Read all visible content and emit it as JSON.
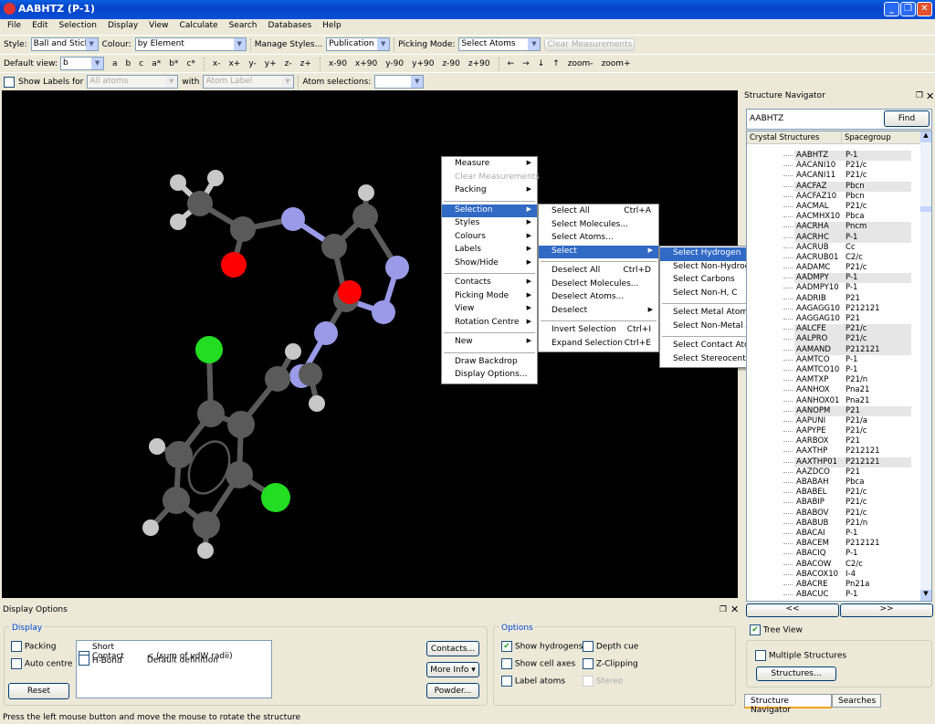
{
  "window": {
    "title": "AABHTZ (P-1)"
  },
  "menubar": [
    "File",
    "Edit",
    "Selection",
    "Display",
    "View",
    "Calculate",
    "Search",
    "Databases",
    "Help"
  ],
  "toolbar1": {
    "style_label": "Style:",
    "style_value": "Ball and Stick",
    "colour_label": "Colour:",
    "colour_value": "by Element",
    "manage_styles": "Manage Styles...",
    "manage_value": "Publication",
    "picking_label": "Picking Mode:",
    "picking_value": "Select Atoms",
    "clear_measurements": "Clear Measurements"
  },
  "toolbar2": {
    "default_view_label": "Default view:",
    "default_view_value": "b",
    "axes": [
      "a",
      "b",
      "c",
      "a*",
      "b*",
      "c*"
    ],
    "rot": [
      "x-",
      "x+",
      "y-",
      "y+",
      "z-",
      "z+"
    ],
    "rot90": [
      "x-90",
      "x+90",
      "y-90",
      "y+90",
      "z-90",
      "z+90"
    ],
    "arrows": [
      "←",
      "→",
      "↓",
      "↑"
    ],
    "zoom": [
      "zoom-",
      "zoom+"
    ]
  },
  "toolbar3": {
    "show_labels": "Show Labels for",
    "labels_for": "All atoms",
    "with": "with",
    "with_value": "Atom Label",
    "atom_selections": "Atom selections:",
    "atom_selections_value": ""
  },
  "context_menu": {
    "main": [
      {
        "label": "Measure",
        "sub": true
      },
      {
        "label": "Clear Measurements",
        "disabled": true
      },
      {
        "label": "Packing",
        "sub": true
      },
      {
        "sep": true
      },
      {
        "label": "Selection",
        "sub": true,
        "hl": true
      },
      {
        "label": "Styles",
        "sub": true
      },
      {
        "label": "Colours",
        "sub": true
      },
      {
        "label": "Labels",
        "sub": true
      },
      {
        "label": "Show/Hide",
        "sub": true
      },
      {
        "sep": true
      },
      {
        "label": "Contacts",
        "sub": true
      },
      {
        "label": "Picking Mode",
        "sub": true
      },
      {
        "label": "View",
        "sub": true
      },
      {
        "label": "Rotation Centre",
        "sub": true
      },
      {
        "sep": true
      },
      {
        "label": "New",
        "sub": true
      },
      {
        "sep": true
      },
      {
        "label": "Draw Backdrop"
      },
      {
        "label": "Display Options..."
      }
    ],
    "selection": [
      {
        "label": "Select All",
        "shortcut": "Ctrl+A"
      },
      {
        "label": "Select Molecules..."
      },
      {
        "label": "Select Atoms..."
      },
      {
        "label": "Select",
        "sub": true,
        "hl": true
      },
      {
        "sep": true
      },
      {
        "label": "Deselect All",
        "shortcut": "Ctrl+D"
      },
      {
        "label": "Deselect Molecules..."
      },
      {
        "label": "Deselect Atoms..."
      },
      {
        "label": "Deselect",
        "sub": true
      },
      {
        "sep": true
      },
      {
        "label": "Invert Selection",
        "shortcut": "Ctrl+I"
      },
      {
        "label": "Expand Selection",
        "shortcut": "Ctrl+E"
      }
    ],
    "select": [
      {
        "label": "Select Hydrogen",
        "hl": true
      },
      {
        "label": "Select Non-Hydrogen"
      },
      {
        "label": "Select Carbons"
      },
      {
        "label": "Select Non-H, C"
      },
      {
        "sep": true
      },
      {
        "label": "Select Metal Atoms"
      },
      {
        "label": "Select Non-Metal Atoms"
      },
      {
        "sep": true
      },
      {
        "label": "Select Contact Atoms"
      },
      {
        "label": "Select Stereocentres"
      }
    ]
  },
  "navigator": {
    "title": "Structure Navigator",
    "search_value": "AABHTZ",
    "find": "Find",
    "col_name": "Crystal Structures",
    "col_sg": "Spacegroup",
    "rows": [
      [
        "AABHTZ",
        "P-1",
        1
      ],
      [
        "AACANI10",
        "P21/c",
        0
      ],
      [
        "AACANI11",
        "P21/c",
        0
      ],
      [
        "AACFAZ",
        "Pbcn",
        1
      ],
      [
        "AACFAZ10",
        "Pbcn",
        0
      ],
      [
        "AACMAL",
        "P21/c",
        0
      ],
      [
        "AACMHX10",
        "Pbca",
        0
      ],
      [
        "AACRHA",
        "Pncm",
        1
      ],
      [
        "AACRHC",
        "P-1",
        1
      ],
      [
        "AACRUB",
        "Cc",
        0
      ],
      [
        "AACRUB01",
        "C2/c",
        0
      ],
      [
        "AADAMC",
        "P21/c",
        0
      ],
      [
        "AADMPY",
        "P-1",
        1
      ],
      [
        "AADMPY10",
        "P-1",
        0
      ],
      [
        "AADRIB",
        "P21",
        0
      ],
      [
        "AAGAGG10",
        "P212121",
        0
      ],
      [
        "AAGGAG10",
        "P21",
        0
      ],
      [
        "AALCFE",
        "P21/c",
        1
      ],
      [
        "AALPRO",
        "P21/c",
        1
      ],
      [
        "AAMAND",
        "P212121",
        1
      ],
      [
        "AAMTCO",
        "P-1",
        0
      ],
      [
        "AAMTCO10",
        "P-1",
        0
      ],
      [
        "AAMTXP",
        "P21/n",
        0
      ],
      [
        "AANHOX",
        "Pna21",
        0
      ],
      [
        "AANHOX01",
        "Pna21",
        0
      ],
      [
        "AANOPM",
        "P21",
        1
      ],
      [
        "AAPUNI",
        "P21/a",
        0
      ],
      [
        "AAPYPE",
        "P21/c",
        0
      ],
      [
        "AARBOX",
        "P21",
        0
      ],
      [
        "AAXTHP",
        "P212121",
        0
      ],
      [
        "AAXTHP01",
        "P212121",
        1
      ],
      [
        "AAZDCO",
        "P21",
        0
      ],
      [
        "ABABAH",
        "Pbca",
        0
      ],
      [
        "ABABEL",
        "P21/c",
        0
      ],
      [
        "ABABIP",
        "P21/c",
        0
      ],
      [
        "ABABOV",
        "P21/c",
        0
      ],
      [
        "ABABUB",
        "P21/n",
        0
      ],
      [
        "ABACAI",
        "P-1",
        0
      ],
      [
        "ABACEM",
        "P212121",
        0
      ],
      [
        "ABACIQ",
        "P-1",
        0
      ],
      [
        "ABACOW",
        "C2/c",
        0
      ],
      [
        "ABACOX10",
        "I-4",
        0
      ],
      [
        "ABACRE",
        "Pn21a",
        0
      ],
      [
        "ABACUC",
        "P-1",
        0
      ]
    ],
    "prev": "<<",
    "next": ">>",
    "tree_view": "Tree View",
    "multiple": "Multiple Structures",
    "structures": "Structures...",
    "tabs": [
      "Structure Navigator",
      "Searches"
    ]
  },
  "display_options": {
    "title": "Display Options",
    "display_group": "Display",
    "packing": "Packing",
    "auto_centre": "Auto centre",
    "reset": "Reset",
    "contacts": [
      {
        "name": "Short Contact",
        "def": "< (sum of vdW radii)"
      },
      {
        "name": "H-Bond",
        "def": "Default definition"
      }
    ],
    "contacts_btn": "Contacts...",
    "more_info": "More Info",
    "powder": "Powder...",
    "options_group": "Options",
    "show_hydrogens": "Show hydrogens",
    "show_hydrogens_checked": true,
    "depth_cue": "Depth cue",
    "show_cell_axes": "Show cell axes",
    "z_clipping": "Z-Clipping",
    "label_atoms": "Label atoms",
    "stereo": "Stereo"
  },
  "status": "Press the left mouse button and move the mouse to rotate the structure",
  "colors": {
    "carbon": "#5a5a5a",
    "hydrogen": "#c8c8c8",
    "nitrogen": "#9a9ae8",
    "oxygen": "#ff0000",
    "chlorine": "#22dd22",
    "highlight": "#316ac5"
  }
}
